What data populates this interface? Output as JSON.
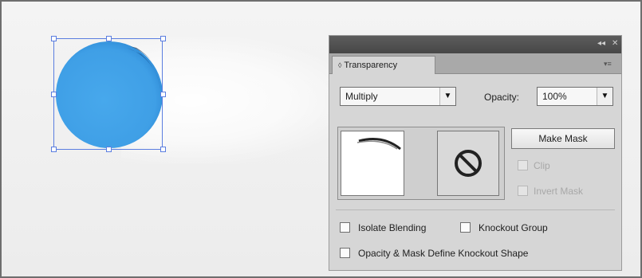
{
  "artboard": {
    "object_fill_color": "#3f9fe6",
    "selection_color": "#5b7ee0"
  },
  "panel": {
    "tab_label": "Transparency",
    "tab_icon": "collapse-toggle-icon",
    "blend_mode": {
      "selected": "Multiply"
    },
    "opacity": {
      "label": "Opacity:",
      "value": "100%"
    },
    "make_mask_label": "Make Mask",
    "clip_label": "Clip",
    "invert_mask_label": "Invert Mask",
    "isolate_blending_label": "Isolate Blending",
    "knockout_group_label": "Knockout Group",
    "opacity_mask_knockout_label": "Opacity & Mask Define Knockout Shape"
  }
}
